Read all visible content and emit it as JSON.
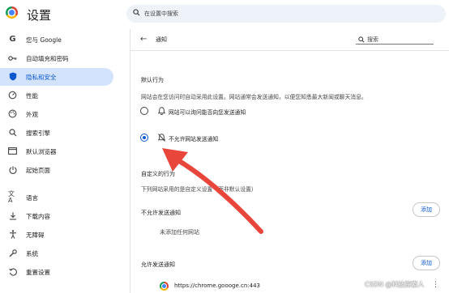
{
  "app": {
    "title": "设置"
  },
  "search": {
    "placeholder": "在设置中搜索"
  },
  "sidebar": {
    "items": [
      {
        "label": "您与 Google",
        "icon": "google-g-icon",
        "active": false
      },
      {
        "label": "自动填充和密码",
        "icon": "key-icon",
        "active": false
      },
      {
        "label": "隐私和安全",
        "icon": "shield-icon",
        "active": true
      },
      {
        "label": "性能",
        "icon": "speedometer-icon",
        "active": false
      },
      {
        "label": "外观",
        "icon": "palette-icon",
        "active": false
      },
      {
        "label": "搜索引擎",
        "icon": "search-icon",
        "active": false
      },
      {
        "label": "默认浏览器",
        "icon": "browser-window-icon",
        "active": false
      },
      {
        "label": "起始页面",
        "icon": "power-icon",
        "active": false
      },
      {
        "label": "语言",
        "icon": "translate-icon",
        "active": false
      },
      {
        "label": "下载内容",
        "icon": "download-icon",
        "active": false
      },
      {
        "label": "无障碍",
        "icon": "accessibility-icon",
        "active": false
      },
      {
        "label": "系统",
        "icon": "wrench-icon",
        "active": false
      },
      {
        "label": "重置设置",
        "icon": "reset-icon",
        "active": false
      }
    ]
  },
  "panel": {
    "title": "通知",
    "search_placeholder": "搜索",
    "default_behavior": {
      "heading": "默认行为",
      "description": "网站会在您访问时自动采用此设置。网站通常会发送通知，以便您知悉最大新闻或聊天消息。",
      "options": [
        {
          "label": "网站可以询问能否向您发送通知",
          "icon": "bell-icon",
          "selected": false
        },
        {
          "label": "不允许网站发送通知",
          "icon": "bell-off-icon",
          "selected": true
        }
      ]
    },
    "custom_behavior": {
      "heading": "自定义的行为",
      "description": "下列网站采用的是自定义设置（而非默认设置）"
    },
    "block_list": {
      "title": "不允许发送通知",
      "add_label": "添加",
      "empty_text": "未添加任何网站"
    },
    "allow_list": {
      "title": "允许发送通知",
      "add_label": "添加",
      "sites": [
        {
          "url": "https://chrome.goooge.cn:443"
        }
      ]
    }
  },
  "watermark": "CSDN @科技探索人",
  "colors": {
    "accent": "#0b57d0",
    "active_bg": "#d3e3fd",
    "arrow": "#e8463a"
  }
}
